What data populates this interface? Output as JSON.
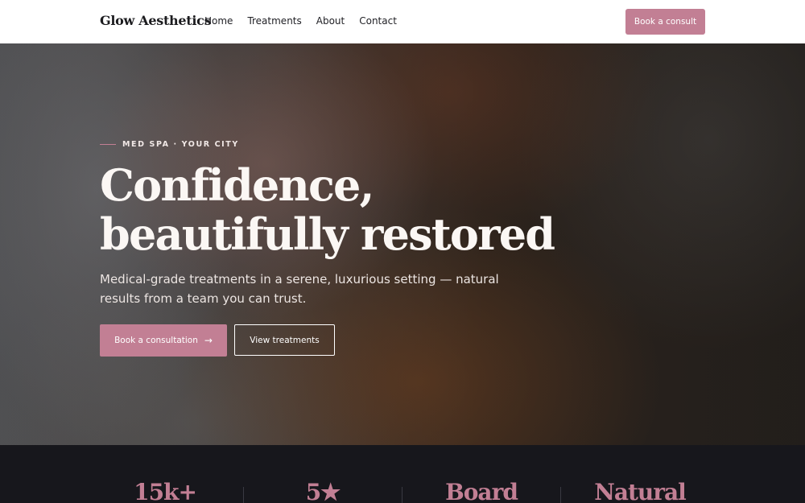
{
  "header": {
    "logo": "Glow Aesthetics",
    "nav": [
      "Home",
      "Treatments",
      "About",
      "Contact"
    ],
    "cta": "Book a consult"
  },
  "hero": {
    "eyebrow": "MED SPA · YOUR CITY",
    "headline": "Confidence, beautifully restored",
    "subcopy": "Medical-grade treatments in a serene, luxurious setting — natural results from a team you can trust.",
    "primary_button": "Book a consultation",
    "primary_arrow": "→",
    "secondary_button": "View treatments"
  },
  "stats": [
    "15k+",
    "5★",
    "Board",
    "Natural"
  ],
  "colors": {
    "accent": "#c27f94",
    "dark": "#17171c",
    "header_bg": "#ffffff"
  }
}
